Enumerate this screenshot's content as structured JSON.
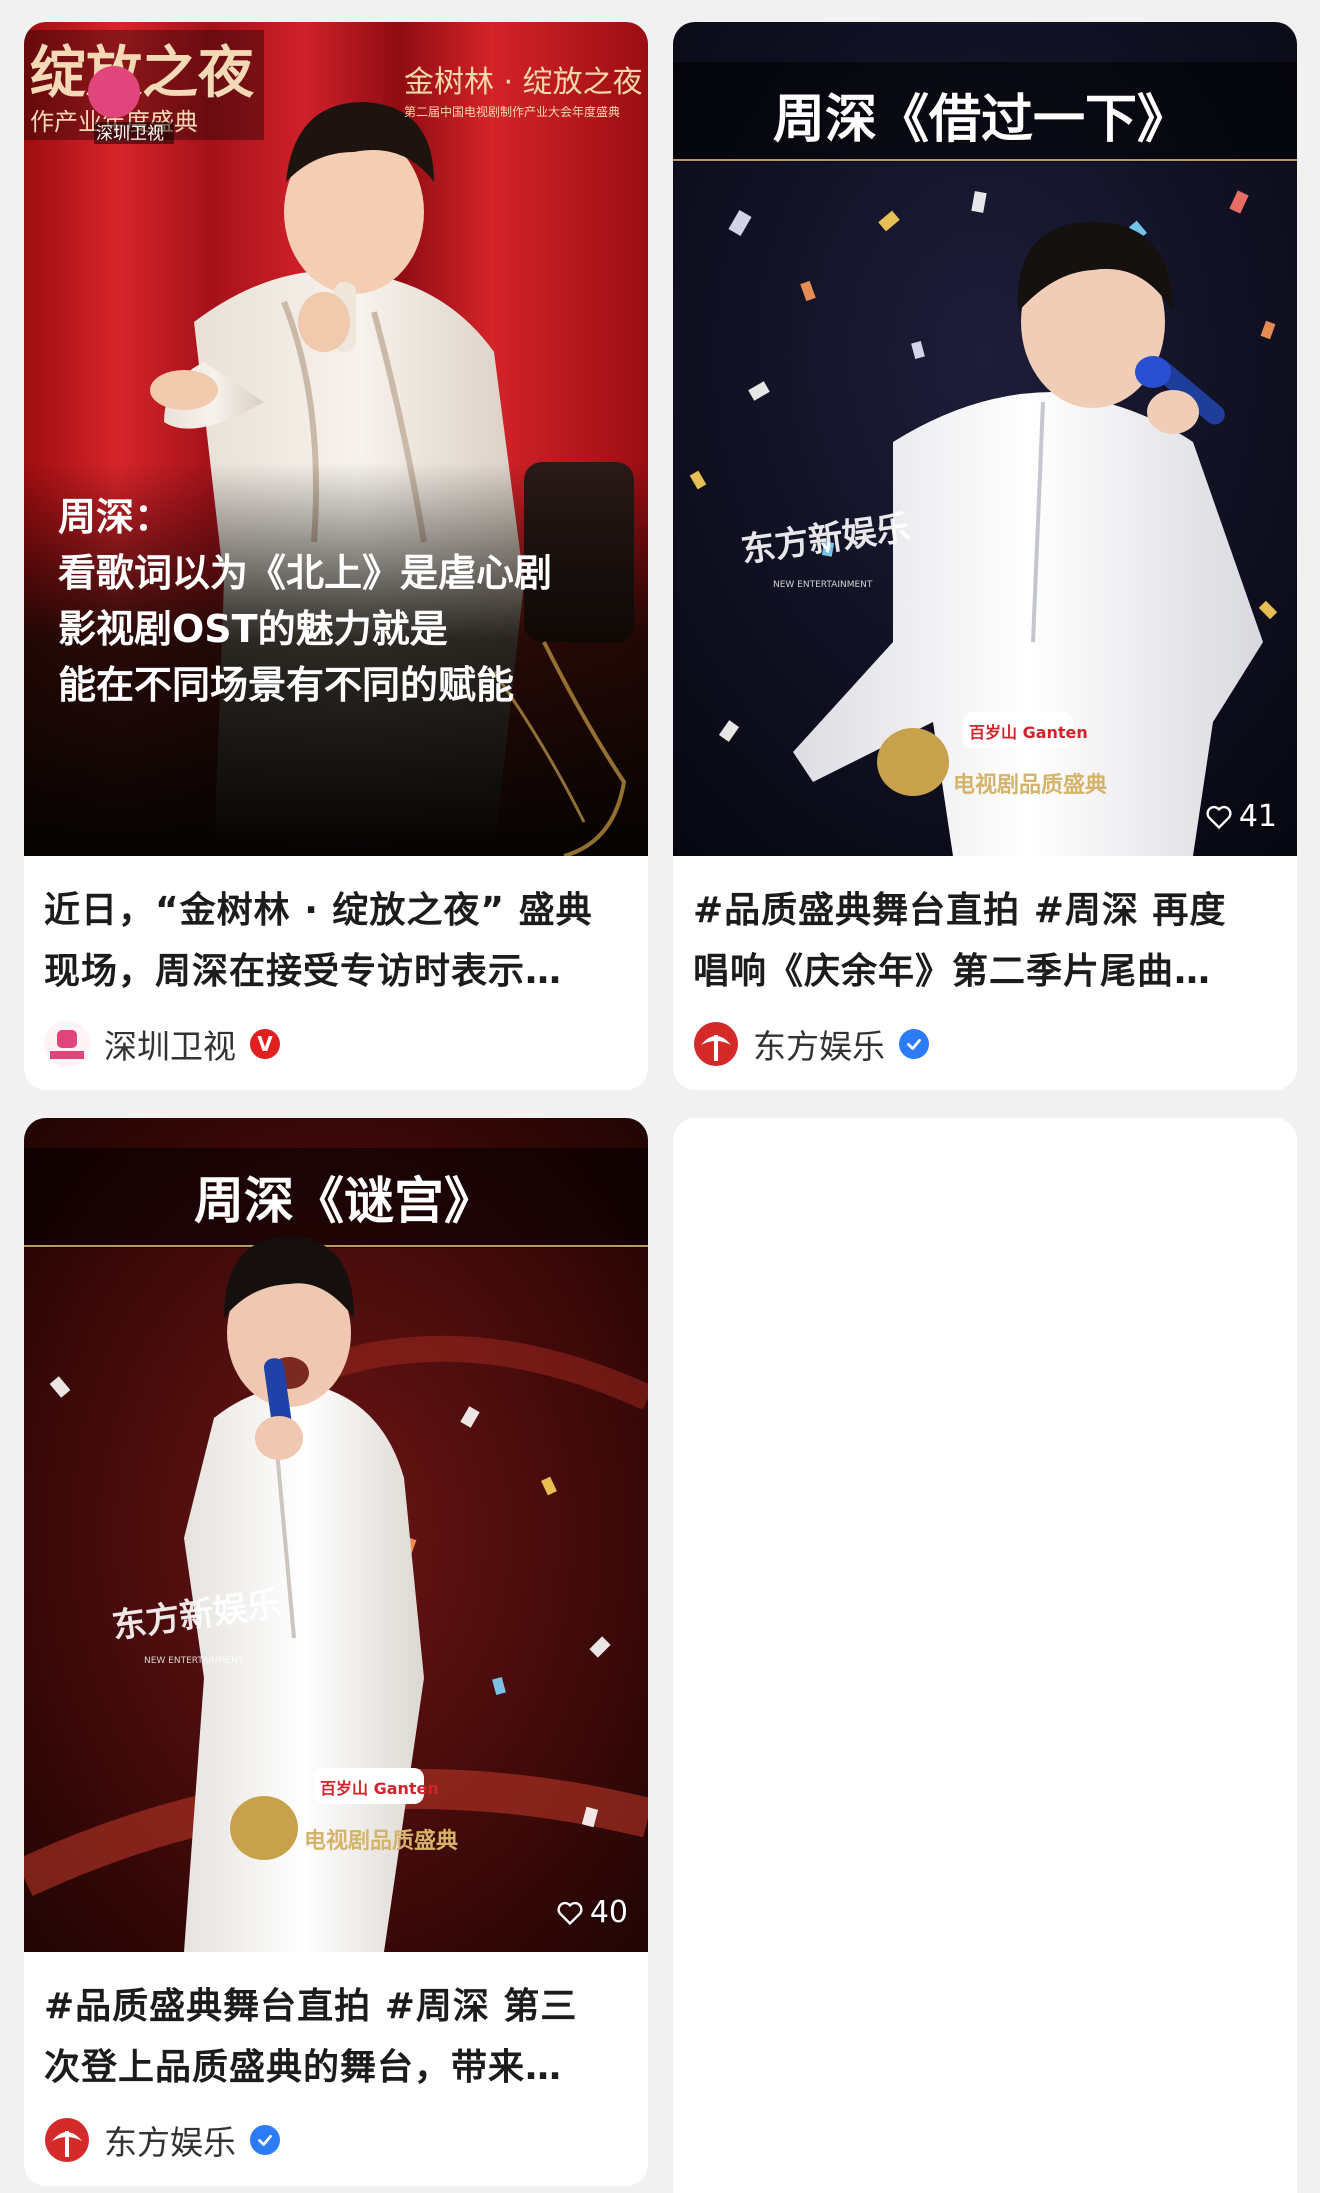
{
  "colors": {
    "page_bg": "#f1f1f1",
    "card_bg": "#ffffff",
    "title_text": "#1c1c1c",
    "author_text": "#333333",
    "badge_red": "#e02020",
    "badge_blue": "#2b7cf6"
  },
  "cards": [
    {
      "cover": {
        "top_title": "绽放之夜",
        "top_sub": "作产业年度盛典",
        "channel_logo_text": "深圳卫视",
        "right_title": "金树林 · 绽放之夜",
        "right_sub": "第二届中国电视剧制作产业大会年度盛典",
        "caption_lines": [
          "周深：",
          "看歌词以为《北上》是虐心剧",
          "影视剧OST的魅力就是",
          "能在不同场景有不同的赋能"
        ]
      },
      "title_lines": [
        "近日，“金树林 · 绽放之夜” 盛典",
        "现场，周深在接受专访时表示…"
      ],
      "author": {
        "name": "深圳卫视",
        "avatar_icon": "shenzhen-tv-logo-icon",
        "avatar_text": "深圳卫视",
        "badge": "red-v-badge-icon",
        "badge_text": "V"
      }
    },
    {
      "cover": {
        "top_title": "周深《借过一下》",
        "watermark_main": "东方新娱乐",
        "watermark_sub": "NEW ENTERTAINMENT",
        "sponsor": "百岁山 Ganten",
        "event_mark": "电视剧品质盛典",
        "likes": "41"
      },
      "title_lines": [
        "#品质盛典舞台直拍 #周深 再度",
        "唱响《庆余年》第二季片尾曲…"
      ],
      "author": {
        "name": "东方娱乐",
        "avatar_icon": "dragon-tv-logo-icon",
        "badge": "blue-verified-badge-icon"
      }
    },
    {
      "cover": {
        "top_title": "周深《谜宫》",
        "watermark_main": "东方新娱乐",
        "watermark_sub": "NEW ENTERTAINMENT",
        "sponsor": "百岁山 Ganten",
        "event_mark": "电视剧品质盛典",
        "likes": "40"
      },
      "title_lines": [
        " #品质盛典舞台直拍 #周深 第三",
        "次登上品质盛典的舞台，带来…"
      ],
      "author": {
        "name": "东方娱乐",
        "avatar_icon": "dragon-tv-logo-icon",
        "badge": "blue-verified-badge-icon"
      }
    }
  ]
}
